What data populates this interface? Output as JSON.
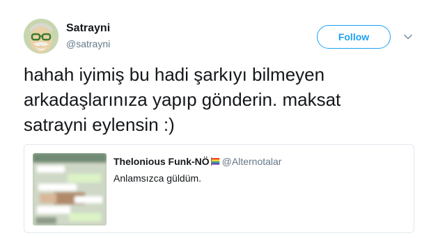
{
  "author": {
    "name": "Satrayni",
    "handle": "@satrayni"
  },
  "follow_label": "Follow",
  "tweet": {
    "line1": "hahah iyimiş bu hadi şarkıyı bilmeyen",
    "line2": "arkadaşlarınıza yapıp gönderin. maksat",
    "line3": "satrayni eylensin :)"
  },
  "quoted": {
    "name": "Thelonious Funk-NÖ",
    "handle": "@Alternotalar",
    "text": "Anlamsızca güldüm."
  },
  "icons": {
    "caret": "chevron-down-icon",
    "flag": "rainbow-flag-icon"
  },
  "colors": {
    "accent": "#1da1f2",
    "text": "#14171a",
    "muted": "#657786",
    "border": "#e1e8ed"
  }
}
